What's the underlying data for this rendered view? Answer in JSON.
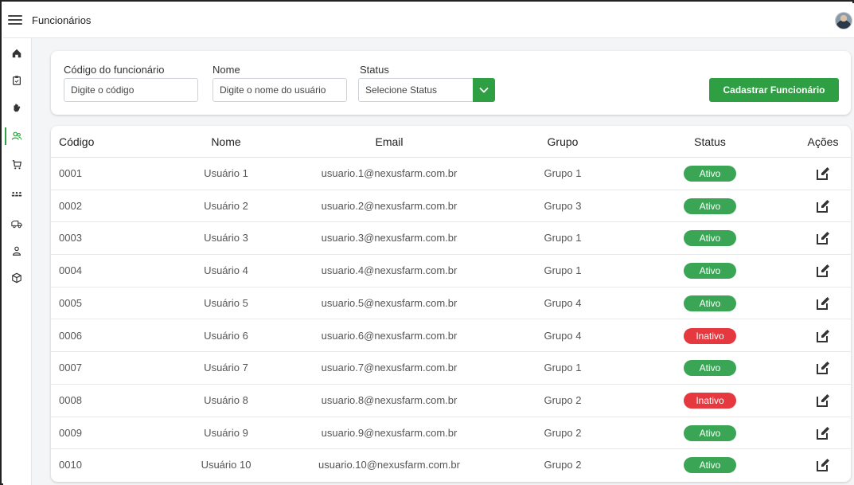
{
  "header": {
    "title": "Funcionários"
  },
  "sidebar": {
    "items": [
      {
        "icon": "home-icon"
      },
      {
        "icon": "clipboard-icon"
      },
      {
        "icon": "hand-icon"
      },
      {
        "icon": "users-icon",
        "active": true
      },
      {
        "icon": "cart-icon"
      },
      {
        "icon": "group-icon"
      },
      {
        "icon": "truck-icon"
      },
      {
        "icon": "user-icon"
      },
      {
        "icon": "box-icon"
      }
    ]
  },
  "filters": {
    "code": {
      "label": "Código do funcionário",
      "placeholder": "Digite o código"
    },
    "name": {
      "label": "Nome",
      "placeholder": "Digite o nome do usuário"
    },
    "status": {
      "label": "Status",
      "value": "Selecione Status"
    },
    "register_button": "Cadastrar Funcionário"
  },
  "table": {
    "headers": {
      "code": "Código",
      "name": "Nome",
      "email": "Email",
      "group": "Grupo",
      "status": "Status",
      "actions": "Ações"
    },
    "rows": [
      {
        "code": "0001",
        "name": "Usuário 1",
        "email": "usuario.1@nexusfarm.com.br",
        "group": "Grupo 1",
        "status": "Ativo"
      },
      {
        "code": "0002",
        "name": "Usuário 2",
        "email": "usuario.2@nexusfarm.com.br",
        "group": "Grupo 3",
        "status": "Ativo"
      },
      {
        "code": "0003",
        "name": "Usuário 3",
        "email": "usuario.3@nexusfarm.com.br",
        "group": "Grupo 1",
        "status": "Ativo"
      },
      {
        "code": "0004",
        "name": "Usuário 4",
        "email": "usuario.4@nexusfarm.com.br",
        "group": "Grupo 1",
        "status": "Ativo"
      },
      {
        "code": "0005",
        "name": "Usuário 5",
        "email": "usuario.5@nexusfarm.com.br",
        "group": "Grupo 4",
        "status": "Ativo"
      },
      {
        "code": "0006",
        "name": "Usuário 6",
        "email": "usuario.6@nexusfarm.com.br",
        "group": "Grupo 4",
        "status": "Inativo"
      },
      {
        "code": "0007",
        "name": "Usuário 7",
        "email": "usuario.7@nexusfarm.com.br",
        "group": "Grupo 1",
        "status": "Ativo"
      },
      {
        "code": "0008",
        "name": "Usuário 8",
        "email": "usuario.8@nexusfarm.com.br",
        "group": "Grupo 2",
        "status": "Inativo"
      },
      {
        "code": "0009",
        "name": "Usuário 9",
        "email": "usuario.9@nexusfarm.com.br",
        "group": "Grupo 2",
        "status": "Ativo"
      },
      {
        "code": "0010",
        "name": "Usuário 10",
        "email": "usuario.10@nexusfarm.com.br",
        "group": "Grupo 2",
        "status": "Ativo"
      }
    ]
  },
  "colors": {
    "accent": "#2ea043",
    "active": "#3aa655",
    "inactive": "#e5393f"
  }
}
